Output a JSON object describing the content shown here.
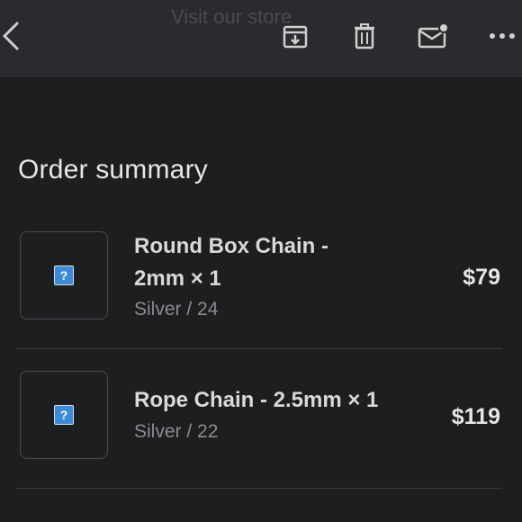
{
  "header": {
    "ghost_title": "Visit our store",
    "icons": [
      "back-icon",
      "archive-icon",
      "trash-icon",
      "mail-unread-icon",
      "more-icon"
    ]
  },
  "section_title": "Order summary",
  "items": [
    {
      "name": "Round Box Chain - 2mm × 1",
      "variant": "Silver / 24",
      "price": "$79",
      "thumbnail_icon": "?"
    },
    {
      "name": "Rope Chain - 2.5mm × 1",
      "variant": "Silver / 22",
      "price": "$119",
      "thumbnail_icon": "?"
    }
  ],
  "colors": {
    "background": "#1d1e20",
    "toolbar": "#2a2b2e",
    "muted_text": "#8a8b8f"
  }
}
